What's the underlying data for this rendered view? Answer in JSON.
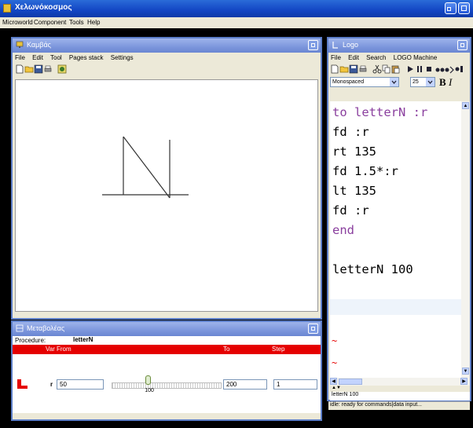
{
  "app": {
    "title": "Χελωνόκοσμος"
  },
  "menubar": [
    "Microworld",
    "Component",
    "Tools",
    "Help"
  ],
  "canvas_window": {
    "title": "Καμβάς",
    "menu": [
      "File",
      "Edit",
      "Tool",
      "Pages stack",
      "Settings"
    ]
  },
  "slider_window": {
    "title": "Μεταβολέας",
    "procedure_label": "Procedure:",
    "procedure_name": "letterN",
    "headers": {
      "var": "Var",
      "from": "From",
      "to": "To",
      "step": "Step"
    },
    "variable": "r",
    "from": "50",
    "to": "200",
    "step": "1",
    "slider_value": "100",
    "slider_fraction": 0.33
  },
  "logo_window": {
    "title": "Logo",
    "menu": [
      "File",
      "Edit",
      "Search",
      "LOGO Machine"
    ],
    "font_family": "Monospaced",
    "font_size": "25",
    "bold_label": "B",
    "italic_label": "I",
    "code_lines": [
      "to letterN :r",
      "fd :r",
      "rt 135",
      "fd 1.5*:r",
      "lt 135",
      "fd :r",
      "end",
      "",
      "letterN 100"
    ],
    "error_marks": [
      "~",
      "~"
    ],
    "command": "letterN 100",
    "status": "idle: ready for commands|data input..."
  },
  "colors": {
    "accent_red": "#e50000",
    "title_blue": "#1346c4",
    "keyword_purple": "#8a3f9e"
  },
  "icons": [
    "app-icon",
    "maximize-icon",
    "canvas-window-icon",
    "slider-window-icon",
    "logo-window-icon",
    "new-icon",
    "open-icon",
    "save-icon",
    "print-icon",
    "cut-icon",
    "copy-icon",
    "paste-icon",
    "run-icon",
    "pause-icon",
    "stop-icon",
    "find-icon"
  ]
}
